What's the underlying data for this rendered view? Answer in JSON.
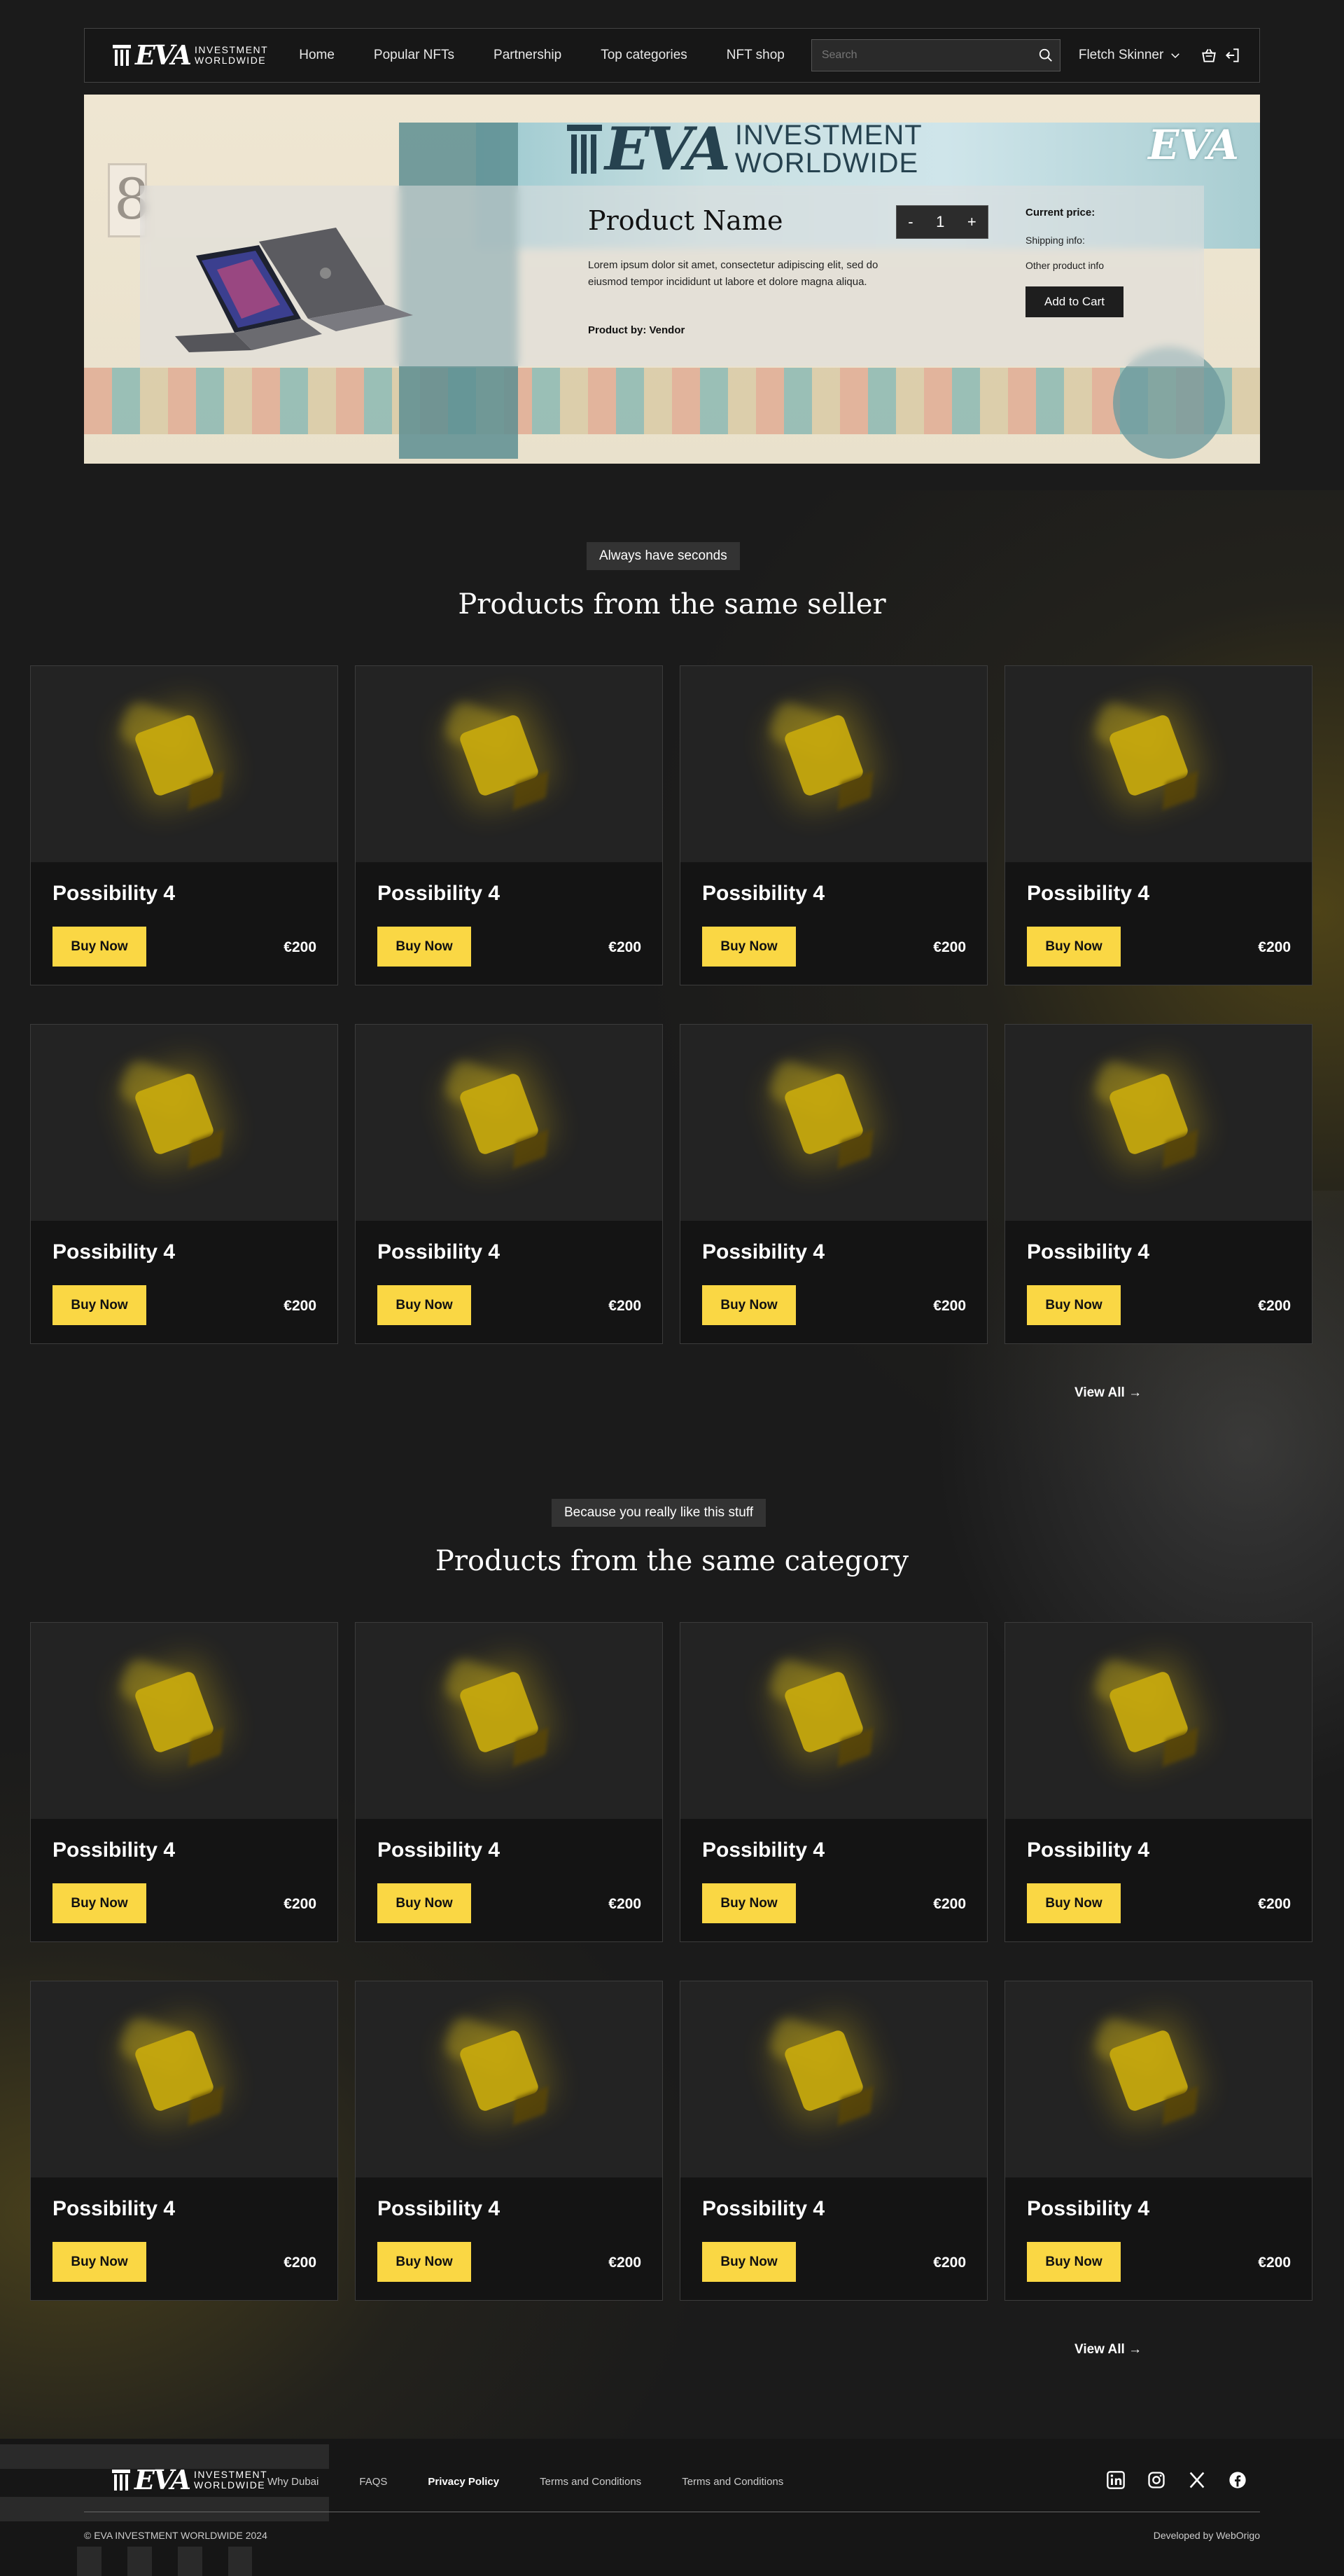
{
  "header": {
    "logo_big": "EVA",
    "logo_line1": "INVESTMENT",
    "logo_line2": "WORLDWIDE",
    "nav": [
      "Home",
      "Popular NFTs",
      "Partnership",
      "Top categories",
      "NFT shop"
    ],
    "search_placeholder": "Search",
    "user_name": "Fletch Skinner"
  },
  "hero": {
    "brand_big": "EVA",
    "brand_line1": "INVESTMENT",
    "brand_line2": "WORLDWIDE",
    "seal_text": "EVA",
    "product_name": "Product Name",
    "description": "Lorem ipsum dolor sit amet, consectetur adipiscing elit, sed do eiusmod tempor incididunt ut labore et dolore magna aliqua.",
    "product_by": "Product by: Vendor",
    "qty_minus": "-",
    "qty_value": "1",
    "qty_plus": "+",
    "current_price_label": "Current price:",
    "shipping_label": "Shipping info:",
    "other_info_label": "Other product info",
    "add_to_cart": "Add to Cart"
  },
  "section_seller": {
    "tag": "Always have seconds",
    "title": "Products from the same seller",
    "view_all": "View All →",
    "products": [
      {
        "title": "Possibility 4",
        "buy": "Buy Now",
        "price": "€200"
      },
      {
        "title": "Possibility 4",
        "buy": "Buy Now",
        "price": "€200"
      },
      {
        "title": "Possibility 4",
        "buy": "Buy Now",
        "price": "€200"
      },
      {
        "title": "Possibility 4",
        "buy": "Buy Now",
        "price": "€200"
      },
      {
        "title": "Possibility 4",
        "buy": "Buy Now",
        "price": "€200"
      },
      {
        "title": "Possibility 4",
        "buy": "Buy Now",
        "price": "€200"
      },
      {
        "title": "Possibility 4",
        "buy": "Buy Now",
        "price": "€200"
      },
      {
        "title": "Possibility 4",
        "buy": "Buy Now",
        "price": "€200"
      }
    ]
  },
  "section_category": {
    "tag": "Because you really like this stuff",
    "title": "Products from the same category",
    "view_all": "View All →",
    "products": [
      {
        "title": "Possibility 4",
        "buy": "Buy Now",
        "price": "€200"
      },
      {
        "title": "Possibility 4",
        "buy": "Buy Now",
        "price": "€200"
      },
      {
        "title": "Possibility 4",
        "buy": "Buy Now",
        "price": "€200"
      },
      {
        "title": "Possibility 4",
        "buy": "Buy Now",
        "price": "€200"
      },
      {
        "title": "Possibility 4",
        "buy": "Buy Now",
        "price": "€200"
      },
      {
        "title": "Possibility 4",
        "buy": "Buy Now",
        "price": "€200"
      },
      {
        "title": "Possibility 4",
        "buy": "Buy Now",
        "price": "€200"
      },
      {
        "title": "Possibility 4",
        "buy": "Buy Now",
        "price": "€200"
      }
    ]
  },
  "footer": {
    "links": [
      "Why Dubai",
      "FAQS",
      "Privacy Policy",
      "Terms and Conditions",
      "Terms and Conditions"
    ],
    "socials": [
      "linkedin-icon",
      "instagram-icon",
      "x-icon",
      "facebook-icon"
    ],
    "copyright": "© EVA INVESTMENT WORLDWIDE 2024",
    "developed_by": "Developed by WebOrigo"
  },
  "colors": {
    "accent": "#fad744",
    "background": "#1b1b1b",
    "card_bg": "#141414"
  }
}
